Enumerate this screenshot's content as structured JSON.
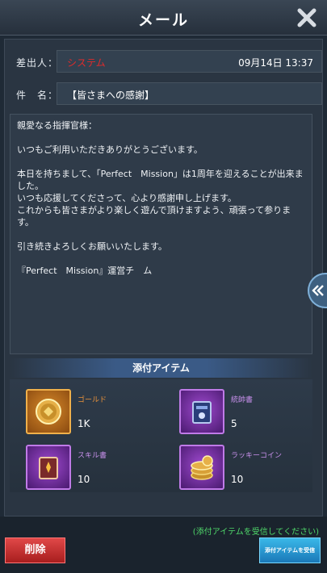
{
  "header": {
    "title": "メール",
    "close_icon": "close-x-icon"
  },
  "mail": {
    "sender_label": "差出人：",
    "sender_value": "システム",
    "date": "09月14日 13:37",
    "subject_label": "件　名：",
    "subject_value": "【皆さまへの感謝】",
    "body": {
      "greeting": "親愛なる指揮官様：",
      "line1": "いつもご利用いただきありがとうございます。",
      "line2": "本日を持ちまして、「Perfect　Mission」は1周年を迎えることが出来ました。",
      "line3": "いつも応援してくださって、心より感謝申し上げます。",
      "line4": "これからも皆さまがより楽しく遊んで頂けますよう、頑張って参ります。",
      "line5": "引き続きよろしくお願いいたします。",
      "signature": "『Perfect　Mission』運営チ　ム"
    }
  },
  "attachments": {
    "title": "添付アイテム",
    "items": [
      {
        "name": "ゴールド",
        "qty": "1K",
        "icon": "gold-coin-icon",
        "rarity_color": "#e8923a"
      },
      {
        "name": "統帥書",
        "qty": "5",
        "icon": "command-book-icon",
        "rarity_color": "#c890ec"
      },
      {
        "name": "スキル書",
        "qty": "10",
        "icon": "skill-book-icon",
        "rarity_color": "#c890ec"
      },
      {
        "name": "ラッキーコイン",
        "qty": "10",
        "icon": "lucky-coins-icon",
        "rarity_color": "#c890ec"
      }
    ]
  },
  "footer": {
    "hint": "(添付アイテムを受信してください)",
    "delete_label": "削除",
    "receive_label": "添付アイテムを受信"
  },
  "colors": {
    "accent_blue": "#3ab8e8",
    "danger_red": "#e04848",
    "hint_green": "#4fd86a"
  }
}
